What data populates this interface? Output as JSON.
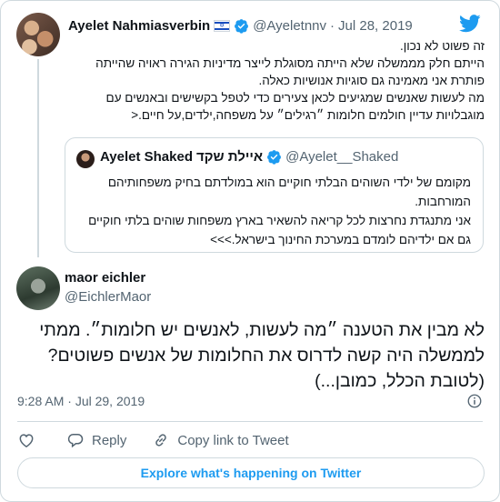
{
  "colors": {
    "accent": "#1d9bf0",
    "text": "#0f1419",
    "muted": "#536471",
    "border": "#cfd9de"
  },
  "icons": [
    "twitter-bird-icon",
    "verified-badge-icon",
    "israel-flag-icon",
    "heart-icon",
    "reply-icon",
    "link-icon",
    "info-icon"
  ],
  "parent": {
    "name": "Ayelet Nahmiasverbin",
    "handle": "@Ayeletnnv",
    "separator": "·",
    "date": "Jul 28, 2019",
    "lines": [
      "זה פשוט לא נכון.",
      "הייתם חלק מממשלה שלא הייתה מסוגלת לייצר מדיניות הגירה ראויה שהייתה פותרת אני מאמינה גם סוגיות אנושיות כאלה.",
      "מה לעשות שאנשים שמגיעים לכאן צעירים כדי לטפל בקשישים ובאנשים עם מוגבלויות עדיין חולמים חלומות ״רגילים״ על משפחה,ילדים,על חיים.<"
    ]
  },
  "quoted": {
    "name_he": "איילת שקד",
    "name_en": "Ayelet Shaked",
    "handle": "@Ayelet__Shaked",
    "lines": [
      "מקומם של ילדי השוהים הבלתי חוקיים הוא במולדתם בחיק משפחותיהם המורחבות.",
      "אני מתנגדת נחרצות לכל קריאה להשאיר בארץ משפחות שוהים בלתי חוקיים גם אם ילדיהם לומדם במערכת החינוך בישראל.>>>"
    ]
  },
  "main": {
    "name": "maor eichler",
    "handle": "@EichlerMaor",
    "text": "לא מבין את הטענה ״מה לעשות, לאנשים יש חלומות״. ממתי לממשלה היה קשה לדרוס את החלומות של אנשים פשוטים? (לטובת הכלל, כמובן...)",
    "time": "9:28 AM",
    "date": "Jul 29, 2019",
    "separator": "·"
  },
  "actions": {
    "reply": "Reply",
    "copy_link": "Copy link to Tweet"
  },
  "explore": "Explore what's happening on Twitter"
}
